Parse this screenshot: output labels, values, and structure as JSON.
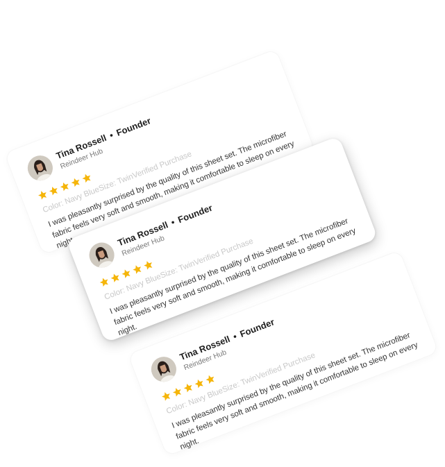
{
  "reviews": [
    {
      "name": "Tina Rossell",
      "role": "Founder",
      "company": "Reindeer Hub",
      "rating": 5,
      "color_label": "Color:",
      "color_value": "Navy Blue",
      "size_label": "Size:",
      "size_value": "Twin",
      "verified": "Verified Purchase",
      "text": "I was pleasantly surprised by the quality of this sheet set. The microfiber fabric feels very soft and smooth, making it comfortable to sleep on every night."
    },
    {
      "name": "Tina Rossell",
      "role": "Founder",
      "company": "Reindeer Hub",
      "rating": 5,
      "color_label": "Color:",
      "color_value": "Navy Blue",
      "size_label": "Size:",
      "size_value": "Twin",
      "verified": "Verified Purchase",
      "text": "I was pleasantly surprised by the quality of this sheet set. The microfiber fabric feels very soft and smooth, making it comfortable to sleep on every night."
    },
    {
      "name": "Tina Rossell",
      "role": "Founder",
      "company": "Reindeer Hub",
      "rating": 5,
      "color_label": "Color:",
      "color_value": "Navy Blue",
      "size_label": "Size:",
      "size_value": "Twin",
      "verified": "Verified Purchase",
      "text": "I was pleasantly surprised by the quality of this sheet set. The microfiber fabric feels very soft and smooth, making it comfortable to sleep on every night."
    }
  ],
  "colors": {
    "star": "#f5b50a",
    "name": "#1d1d1d",
    "meta": "#c8c8c8",
    "body": "#333333"
  },
  "icons": {
    "star": "star-icon",
    "avatar": "avatar"
  }
}
